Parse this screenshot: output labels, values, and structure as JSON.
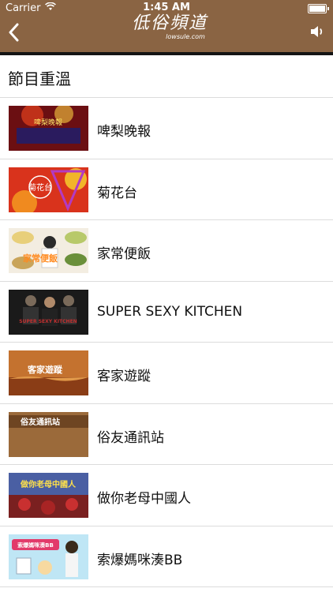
{
  "status": {
    "carrier": "Carrier",
    "time": "1:45 AM"
  },
  "header": {
    "logo_text": "低俗頻道",
    "logo_url_text": "lowsule.com"
  },
  "section": {
    "title": "節目重溫"
  },
  "programs": [
    {
      "label": "啤梨晚報",
      "thumb_text": "啤梨晚報"
    },
    {
      "label": "菊花台",
      "thumb_text": "菊花台"
    },
    {
      "label": "家常便飯",
      "thumb_text": "家常便飯"
    },
    {
      "label": "SUPER SEXY KITCHEN",
      "thumb_text": "SUPER SEXY KITCHEN"
    },
    {
      "label": "客家遊蹤",
      "thumb_text": "客家遊蹤"
    },
    {
      "label": "俗友通訊站",
      "thumb_text": "俗友通訊站"
    },
    {
      "label": "做你老母中國人",
      "thumb_text": "做你老母中國人"
    },
    {
      "label": "索爆媽咪湊BB",
      "thumb_text": "索爆媽咪湊BB"
    }
  ],
  "colors": {
    "header": "#8a6443",
    "divider": "#dcdcdc"
  }
}
